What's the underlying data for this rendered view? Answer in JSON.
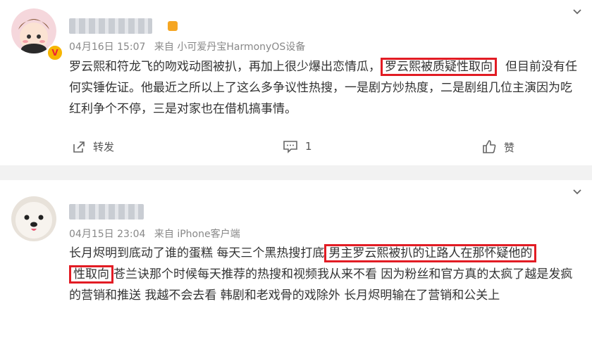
{
  "posts": [
    {
      "meta": "04月16日 15:07",
      "source": "来自 小可爱丹宝HarmonyOS设备",
      "text_before": "罗云熙和符龙飞的吻戏动图被扒，再加上很少爆出恋情瓜，",
      "highlight": "罗云熙被质疑性取向",
      "text_after": "但目前没有任何实锤佐证。他最近之所以上了这么多争议性热搜，一是剧方炒热度，二是剧组几位主演因为吃红利争个不停，三是对家也在借机搞事情。",
      "verified_badge": "V",
      "actions": {
        "share": "转发",
        "comment_count": "1",
        "like": "赞"
      }
    },
    {
      "meta": "04月15日 23:04",
      "source": "来自 iPhone客户端",
      "text_before": "长月烬明到底动了谁的蛋糕 每天三个黑热搜打底",
      "highlight_1": "男主罗云熙被扒的让路人在那怀疑他的",
      "highlight_2": "性取向",
      "text_after": "苍兰诀那个时候每天推荐的热搜和视频我从来不看 因为粉丝和官方真的太疯了越是发疯的营销和推送 我越不会去看 韩剧和老戏骨的戏除外 长月烬明输在了营销和公关上"
    }
  ],
  "colors": {
    "highlight_border": "#e21c24",
    "page_bg": "#f2f2f2",
    "card_bg": "#ffffff"
  }
}
